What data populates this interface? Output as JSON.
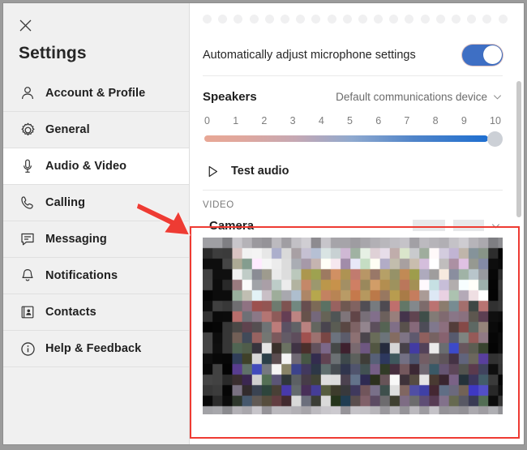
{
  "window": {
    "title": "Settings",
    "close_icon": "close-icon"
  },
  "sidebar": {
    "title": "Settings",
    "items": [
      {
        "label": "Account & Profile",
        "icon": "person-icon",
        "active": false
      },
      {
        "label": "General",
        "icon": "gear-icon",
        "active": false
      },
      {
        "label": "Audio & Video",
        "icon": "microphone-icon",
        "active": true
      },
      {
        "label": "Calling",
        "icon": "phone-icon",
        "active": false
      },
      {
        "label": "Messaging",
        "icon": "chat-icon",
        "active": false
      },
      {
        "label": "Notifications",
        "icon": "bell-icon",
        "active": false
      },
      {
        "label": "Contacts",
        "icon": "contact-card-icon",
        "active": false
      },
      {
        "label": "Help & Feedback",
        "icon": "info-circle-icon",
        "active": false
      }
    ]
  },
  "panel": {
    "mic_meter": {
      "dots_total": 20,
      "dots_filled": 0,
      "dot_color": "#f0f0f1"
    },
    "auto_adjust": {
      "label": "Automatically adjust microphone settings",
      "toggle_state": "on",
      "toggle_color": "#3e6fc4"
    },
    "speakers": {
      "heading": "Speakers",
      "device": "Default communications device",
      "chevron_icon": "chevron-down-icon",
      "ticks": [
        "0",
        "1",
        "2",
        "3",
        "4",
        "5",
        "6",
        "7",
        "8",
        "9",
        "10"
      ],
      "volume_value": 10,
      "volume_min": 0,
      "volume_max": 10
    },
    "test_audio": {
      "label": "Test audio",
      "icon": "play-icon"
    },
    "video_section": {
      "heading": "VIDEO",
      "camera_label": "Camera",
      "camera_device": "",
      "camera_device_redacted": true,
      "chevron_icon": "chevron-down-icon"
    }
  },
  "annotations": {
    "highlight_box_color": "#ee3b33",
    "arrow_color": "#ee3b33",
    "arrow_name": "red-pointer-arrow"
  }
}
